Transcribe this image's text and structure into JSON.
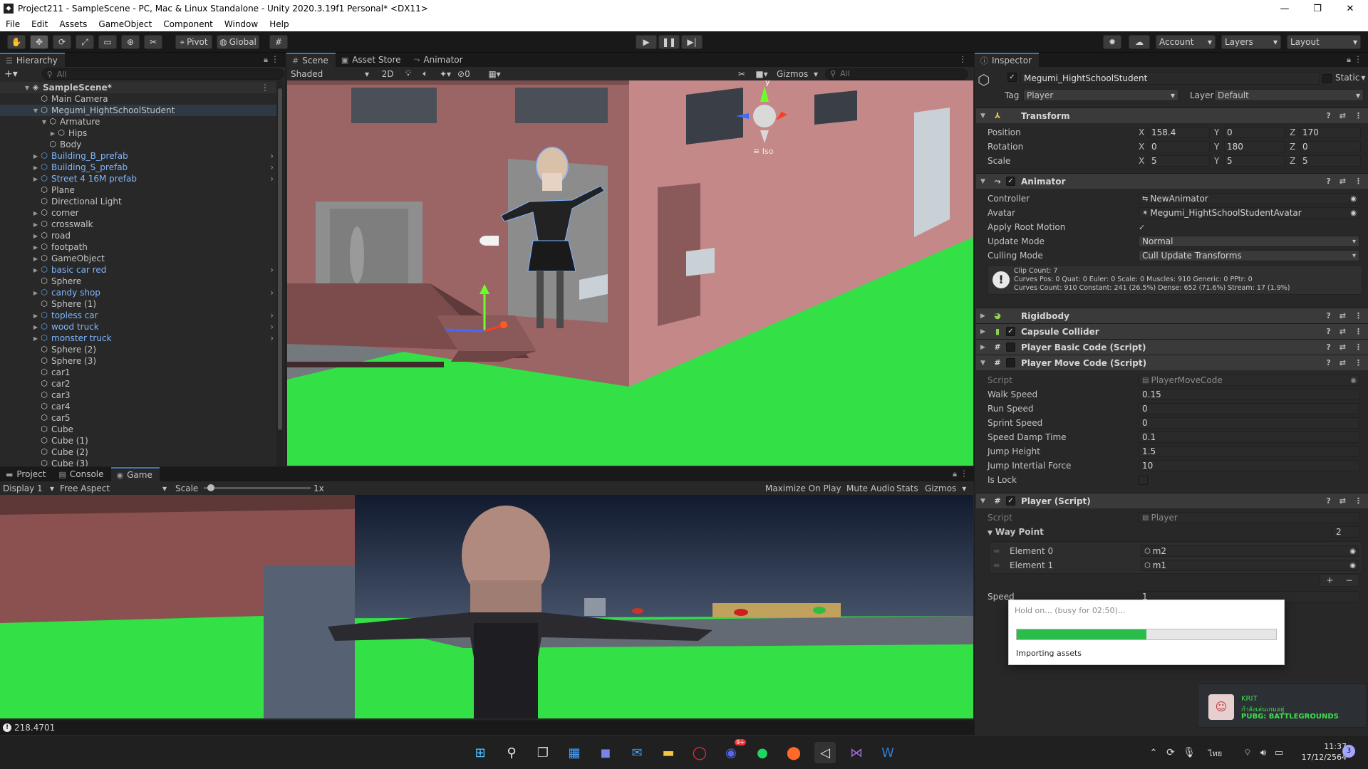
{
  "window": {
    "title": "Project211 - SampleScene - PC, Mac & Linux Standalone - Unity 2020.3.19f1 Personal* <DX11>",
    "minimize": "—",
    "maximize": "❐",
    "close": "✕"
  },
  "menu": [
    "File",
    "Edit",
    "Assets",
    "GameObject",
    "Component",
    "Window",
    "Help"
  ],
  "toolbar": {
    "pivot": "Pivot",
    "global": "Global",
    "account": "Account",
    "layers": "Layers",
    "layout": "Layout"
  },
  "hierarchy": {
    "tab": "Hierarchy",
    "search_placeholder": "All",
    "scene": "SampleScene*",
    "items": [
      {
        "label": "Main Camera",
        "depth": 1,
        "prefab": false,
        "arrow": "",
        "sel": false
      },
      {
        "label": "Megumi_HightSchoolStudent",
        "depth": 1,
        "prefab": false,
        "arrow": "▼",
        "sel": true
      },
      {
        "label": "Armature",
        "depth": 2,
        "prefab": false,
        "arrow": "▼",
        "sel": false
      },
      {
        "label": "Hips",
        "depth": 3,
        "prefab": false,
        "arrow": "▶",
        "sel": false
      },
      {
        "label": "Body",
        "depth": 2,
        "prefab": false,
        "arrow": "",
        "sel": false
      },
      {
        "label": "Building_B_prefab",
        "depth": 1,
        "prefab": true,
        "arrow": "▶",
        "sel": false
      },
      {
        "label": "Building_S_prefab",
        "depth": 1,
        "prefab": true,
        "arrow": "▶",
        "sel": false
      },
      {
        "label": "Street 4 16M prefab",
        "depth": 1,
        "prefab": true,
        "arrow": "▶",
        "sel": false
      },
      {
        "label": "Plane",
        "depth": 1,
        "prefab": false,
        "arrow": "",
        "sel": false
      },
      {
        "label": "Directional Light",
        "depth": 1,
        "prefab": false,
        "arrow": "",
        "sel": false
      },
      {
        "label": "corner",
        "depth": 1,
        "prefab": false,
        "arrow": "▶",
        "sel": false
      },
      {
        "label": "crosswalk",
        "depth": 1,
        "prefab": false,
        "arrow": "▶",
        "sel": false
      },
      {
        "label": "road",
        "depth": 1,
        "prefab": false,
        "arrow": "▶",
        "sel": false
      },
      {
        "label": "footpath",
        "depth": 1,
        "prefab": false,
        "arrow": "▶",
        "sel": false
      },
      {
        "label": "GameObject",
        "depth": 1,
        "prefab": false,
        "arrow": "▶",
        "sel": false
      },
      {
        "label": "basic car red",
        "depth": 1,
        "prefab": true,
        "arrow": "▶",
        "sel": false
      },
      {
        "label": "Sphere",
        "depth": 1,
        "prefab": false,
        "arrow": "",
        "sel": false
      },
      {
        "label": "candy shop",
        "depth": 1,
        "prefab": true,
        "arrow": "▶",
        "sel": false
      },
      {
        "label": "Sphere (1)",
        "depth": 1,
        "prefab": false,
        "arrow": "",
        "sel": false
      },
      {
        "label": "topless car",
        "depth": 1,
        "prefab": true,
        "arrow": "▶",
        "sel": false
      },
      {
        "label": "wood truck",
        "depth": 1,
        "prefab": true,
        "arrow": "▶",
        "sel": false
      },
      {
        "label": "monster truck",
        "depth": 1,
        "prefab": true,
        "arrow": "▶",
        "sel": false
      },
      {
        "label": "Sphere (2)",
        "depth": 1,
        "prefab": false,
        "arrow": "",
        "sel": false
      },
      {
        "label": "Sphere (3)",
        "depth": 1,
        "prefab": false,
        "arrow": "",
        "sel": false
      },
      {
        "label": "car1",
        "depth": 1,
        "prefab": false,
        "arrow": "",
        "sel": false
      },
      {
        "label": "car2",
        "depth": 1,
        "prefab": false,
        "arrow": "",
        "sel": false
      },
      {
        "label": "car3",
        "depth": 1,
        "prefab": false,
        "arrow": "",
        "sel": false
      },
      {
        "label": "car4",
        "depth": 1,
        "prefab": false,
        "arrow": "",
        "sel": false
      },
      {
        "label": "car5",
        "depth": 1,
        "prefab": false,
        "arrow": "",
        "sel": false
      },
      {
        "label": "Cube",
        "depth": 1,
        "prefab": false,
        "arrow": "",
        "sel": false
      },
      {
        "label": "Cube (1)",
        "depth": 1,
        "prefab": false,
        "arrow": "",
        "sel": false
      },
      {
        "label": "Cube (2)",
        "depth": 1,
        "prefab": false,
        "arrow": "",
        "sel": false
      },
      {
        "label": "Cube (3)",
        "depth": 1,
        "prefab": false,
        "arrow": "",
        "sel": false
      }
    ]
  },
  "scene": {
    "tabs": [
      "Scene",
      "Asset Store",
      "Animator"
    ],
    "shading": "Shaded",
    "mode2d": "2D",
    "hidden_count": "0",
    "gizmos": "Gizmos",
    "search_placeholder": "All",
    "iso": "Iso",
    "gizmo_y": "y"
  },
  "bottom": {
    "tabs": [
      "Project",
      "Console",
      "Game"
    ],
    "display": "Display 1",
    "aspect": "Free Aspect",
    "scale_label": "Scale",
    "scale_value": "1x",
    "scale_fraction": 0.03,
    "maximize": "Maximize On Play",
    "mute": "Mute Audio",
    "stats": "Stats",
    "gizmos": "Gizmos"
  },
  "inspector": {
    "tab": "Inspector",
    "object_name": "Megumi_HightSchoolStudent",
    "static": "Static",
    "tag_label": "Tag",
    "tag": "Player",
    "layer_label": "Layer",
    "layer": "Default",
    "transform": {
      "title": "Transform",
      "position": {
        "label": "Position",
        "x": "158.4",
        "y": "0",
        "z": "170"
      },
      "rotation": {
        "label": "Rotation",
        "x": "0",
        "y": "180",
        "z": "0"
      },
      "scale": {
        "label": "Scale",
        "x": "5",
        "y": "5",
        "z": "5"
      }
    },
    "animator": {
      "title": "Animator",
      "controller_label": "Controller",
      "controller": "NewAnimator",
      "avatar_label": "Avatar",
      "avatar": "Megumi_HightSchoolStudentAvatar",
      "root_motion_label": "Apply Root Motion",
      "update_mode_label": "Update Mode",
      "update_mode": "Normal",
      "culling_label": "Culling Mode",
      "culling": "Cull Update Transforms",
      "info1": "Clip Count: 7",
      "info2": "Curves Pos: 0 Quat: 0 Euler: 0 Scale: 0 Muscles: 910 Generic: 0 PPtr: 0",
      "info3": "Curves Count: 910 Constant: 241 (26.5%) Dense: 652 (71.6%) Stream: 17 (1.9%)"
    },
    "rigidbody": "Rigidbody",
    "capsule": "Capsule Collider",
    "basic_code": "Player Basic Code (Script)",
    "move_code": {
      "title": "Player Move Code (Script)",
      "script_label": "Script",
      "script": "PlayerMoveCode",
      "fields": [
        {
          "label": "Walk Speed",
          "value": "0.15"
        },
        {
          "label": "Run Speed",
          "value": "0"
        },
        {
          "label": "Sprint Speed",
          "value": "0"
        },
        {
          "label": "Speed Damp Time",
          "value": "0.1"
        },
        {
          "label": "Jump Height",
          "value": "1.5"
        },
        {
          "label": "Jump Intertial Force",
          "value": "10"
        }
      ],
      "is_lock_label": "Is Lock"
    },
    "player": {
      "title": "Player (Script)",
      "script_label": "Script",
      "script": "Player",
      "waypoint_label": "Way Point",
      "waypoint_count": "2",
      "elements": [
        {
          "label": "Element 0",
          "value": "m2"
        },
        {
          "label": "Element 1",
          "value": "m1"
        }
      ],
      "speed_label": "Speed",
      "speed": "1"
    }
  },
  "progress": {
    "title": "Hold on... (busy for 02:50)...",
    "fraction": 0.5,
    "status": "Importing assets"
  },
  "status_bar": {
    "text": "218.4701"
  },
  "notification": {
    "name": "KRIT",
    "line": "กำลังเล่นเกมอยู่",
    "game": "PUBG: BATTLEGROUNDS"
  },
  "taskbar": {
    "lang": "ไทย",
    "time": "11:37",
    "date": "17/12/2564",
    "discord_badge": "9+",
    "notif_count": "3"
  },
  "colors": {
    "accent": "#3a79bb",
    "ground": "#33e046",
    "prefab": "#7fb6ff",
    "progress": "#2bbd49"
  }
}
